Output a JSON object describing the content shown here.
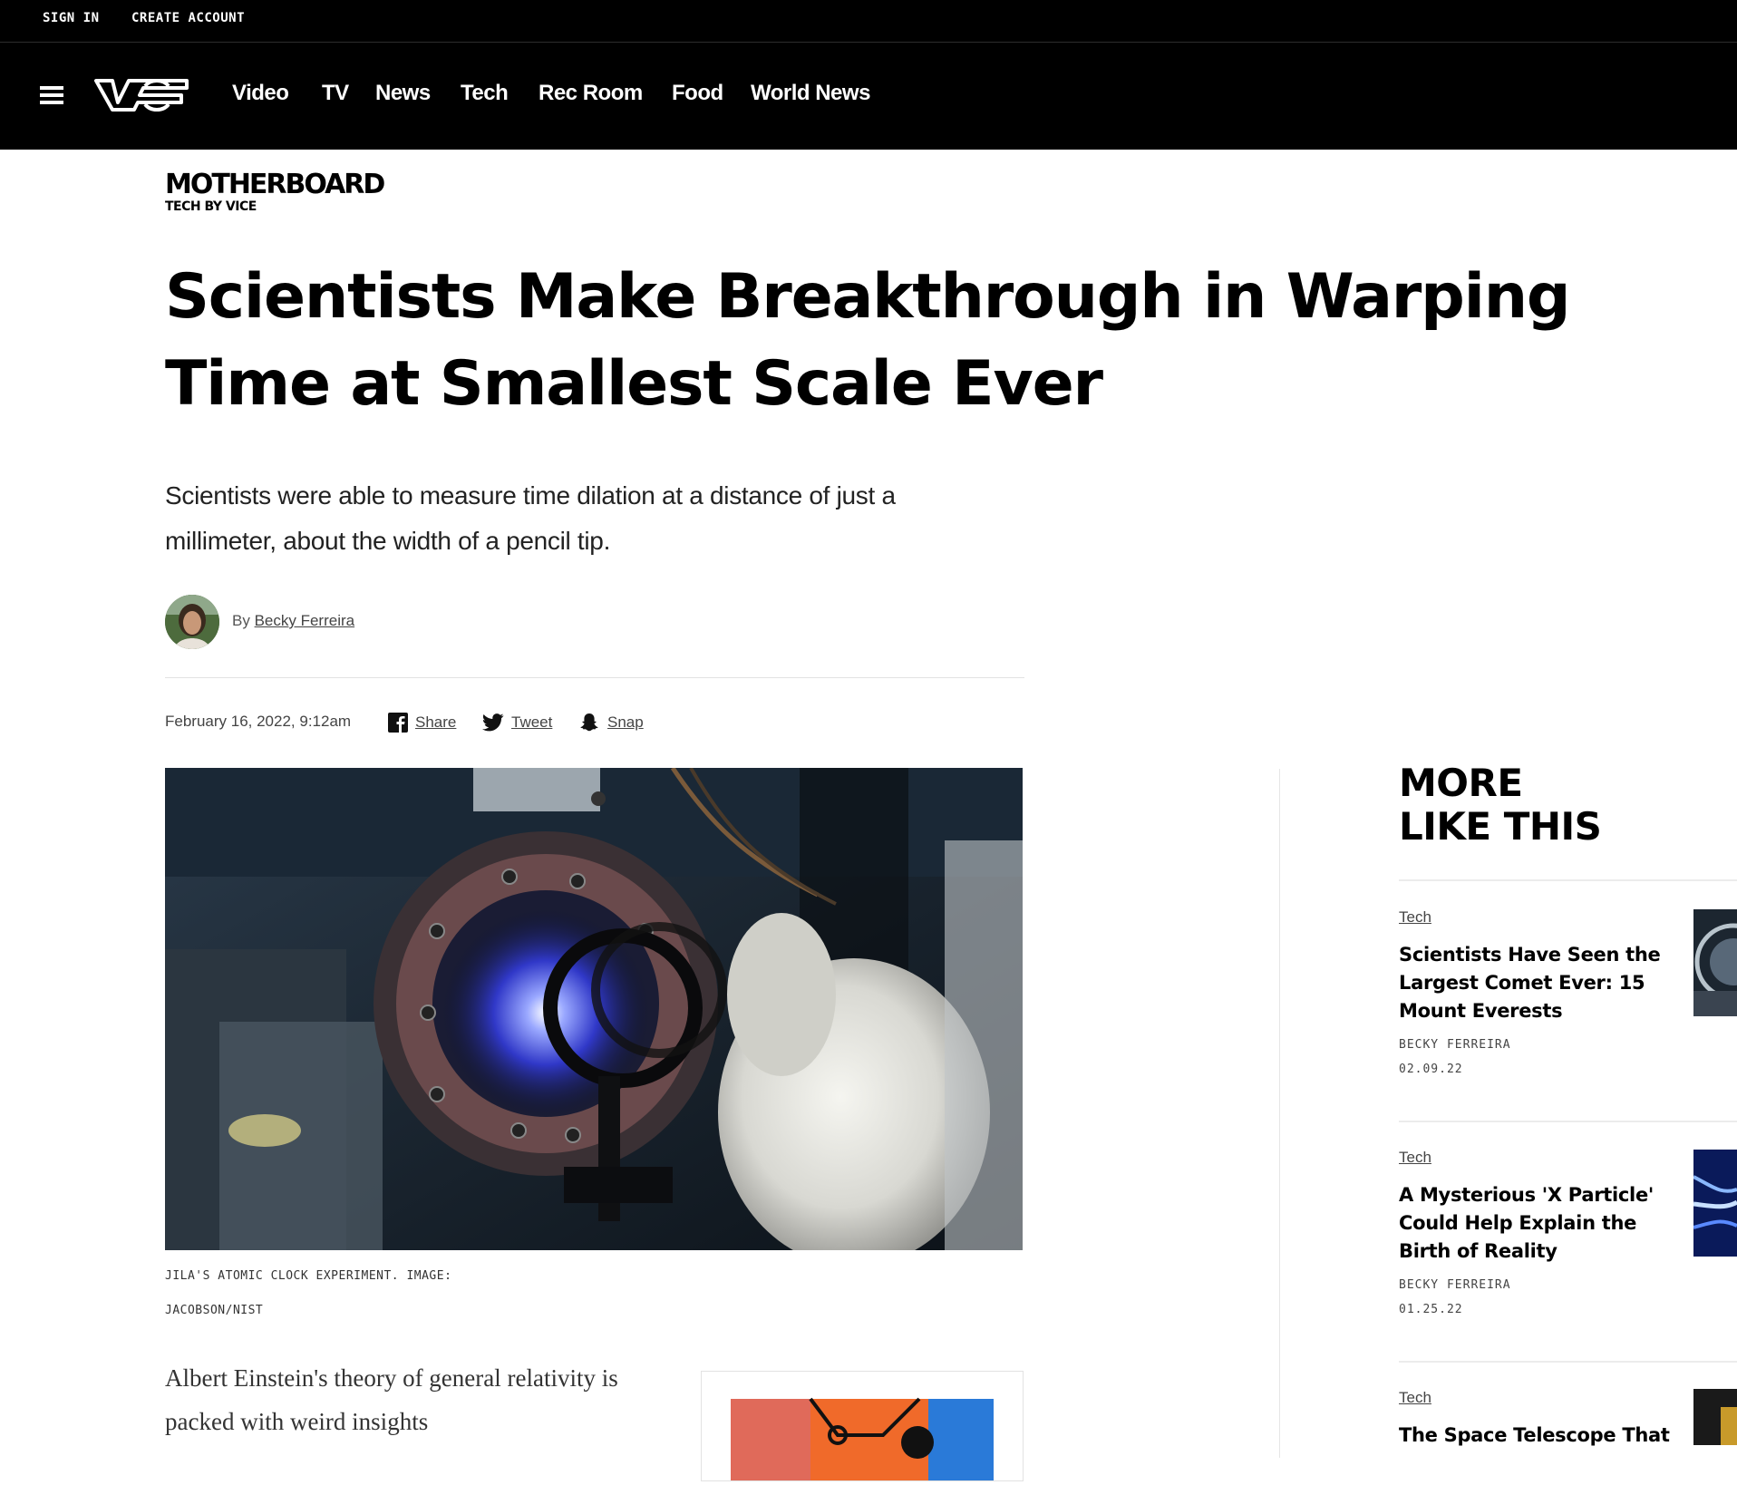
{
  "utility": {
    "sign_in": "SIGN IN",
    "create_account": "CREATE ACCOUNT"
  },
  "nav": {
    "logo_icon": "vice-logo",
    "items": [
      "Video",
      "TV",
      "News",
      "Tech",
      "Rec Room",
      "Food",
      "World News"
    ]
  },
  "brand": {
    "title": "MOTHERBOARD",
    "subtitle": "TECH BY VICE"
  },
  "article": {
    "headline": "Scientists Make Breakthrough in Warping Time at Smallest Scale Ever",
    "dek": "Scientists were able to measure time dilation at a distance of just a millimeter, about the width of a pencil tip.",
    "byline_prefix": "By",
    "author": "Becky Ferreira",
    "date": "February 16, 2022, 9:12am",
    "share": {
      "facebook": "Share",
      "twitter": "Tweet",
      "snapchat": "Snap"
    },
    "caption": "JILA'S ATOMIC CLOCK EXPERIMENT. IMAGE: JACOBSON/NIST",
    "body_first": "Albert Einstein's theory of general relativity is packed with weird insights"
  },
  "sidebar": {
    "title_line1": "MORE",
    "title_line2": "LIKE THIS",
    "cards": [
      {
        "category": "Tech",
        "title": "Scientists Have Seen the Largest Comet Ever: 15 Mount Everests",
        "author": "BECKY FERREIRA",
        "date": "02.09.22"
      },
      {
        "category": "Tech",
        "title": "A Mysterious 'X Particle' Could Help Explain the Birth of Reality",
        "author": "BECKY FERREIRA",
        "date": "01.25.22"
      },
      {
        "category": "Tech",
        "title": "The Space Telescope That",
        "author": "",
        "date": ""
      }
    ]
  },
  "colors": {
    "nav_bg": "#000000",
    "text": "#000000",
    "muted": "#444444",
    "divider": "#e2e2e2"
  }
}
